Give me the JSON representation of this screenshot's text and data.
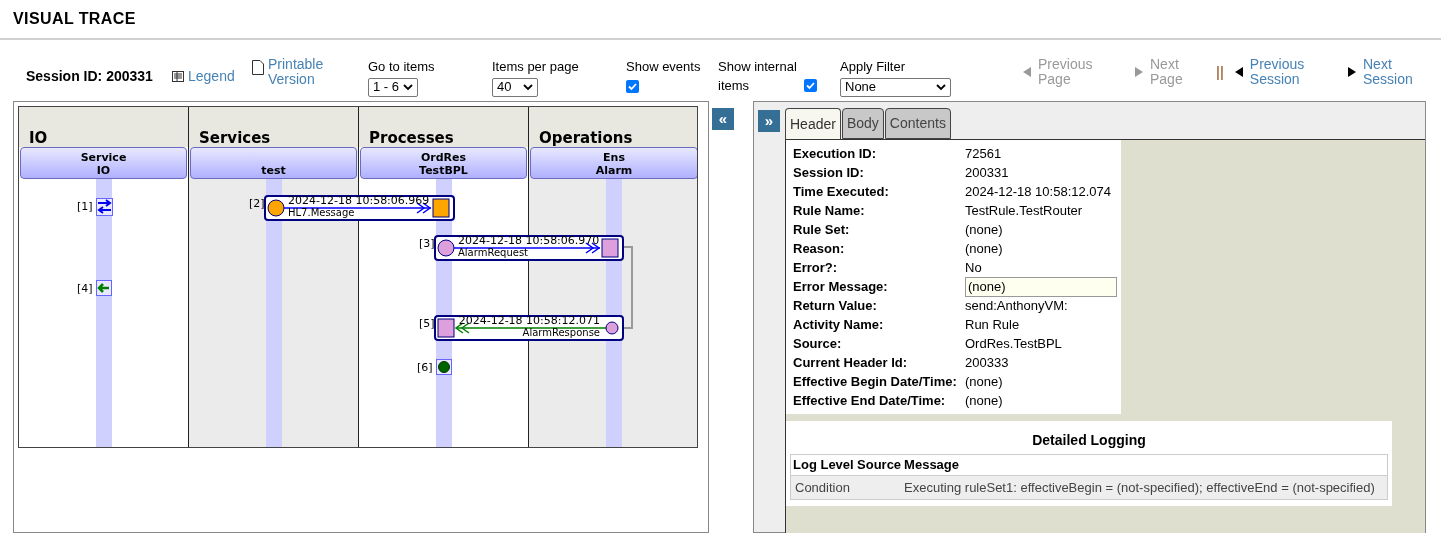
{
  "page_title": "VISUAL TRACE",
  "toolbar": {
    "session_label": "Session ID: 200331",
    "legend_link": "Legend",
    "printable_link": "Printable Version",
    "go_to_items": {
      "label": "Go to items",
      "value": "1 - 6"
    },
    "items_per_page": {
      "label": "Items per page",
      "value": "40"
    },
    "show_events": {
      "label": "Show events",
      "checked": true
    },
    "show_internal": {
      "label": "Show internal items",
      "checked": true
    },
    "apply_filter": {
      "label": "Apply Filter",
      "value": "None"
    },
    "nav": [
      {
        "kind": "prev",
        "label": "Previous Page",
        "disabled": true
      },
      {
        "kind": "next",
        "label": "Next Page",
        "disabled": true
      },
      {
        "kind": "prev",
        "label": "Previous Session",
        "disabled": false
      },
      {
        "kind": "next",
        "label": "Next Session",
        "disabled": false
      }
    ],
    "separator": "||"
  },
  "collapse_left": "«",
  "collapse_right": "»",
  "lanes": [
    {
      "title": "IO",
      "node": [
        "Service",
        "IO"
      ]
    },
    {
      "title": "Services",
      "node": [
        "test"
      ]
    },
    {
      "title": "Processes",
      "node": [
        "OrdRes",
        "TestBPL"
      ]
    },
    {
      "title": "Operations",
      "node": [
        "Ens",
        "Alarm"
      ]
    }
  ],
  "events": [
    {
      "index": "[1]",
      "kind": "io-both"
    },
    {
      "index": "[2]",
      "kind": "request",
      "time": "2024-12-18 10:58:06.969",
      "name": "HL7.Message",
      "color": "#ffa500"
    },
    {
      "index": "[3]",
      "kind": "request",
      "time": "2024-12-18 10:58:06.970",
      "name": "AlarmRequest",
      "color": "#dda0dd"
    },
    {
      "index": "[4]",
      "kind": "io-in"
    },
    {
      "index": "[5]",
      "kind": "response",
      "time": "2024-12-18 10:58:12.071",
      "name": "AlarmResponse",
      "color": "#dda0dd"
    },
    {
      "index": "[6]",
      "kind": "complete"
    }
  ],
  "tabs": [
    {
      "label": "Header",
      "selected": true
    },
    {
      "label": "Body",
      "selected": false
    },
    {
      "label": "Contents",
      "selected": false
    }
  ],
  "header_fields": [
    {
      "label": "Execution ID:",
      "value": "72561"
    },
    {
      "label": "Session ID:",
      "value": "200331"
    },
    {
      "label": "Time Executed:",
      "value": "2024-12-18 10:58:12.074"
    },
    {
      "label": "Rule Name:",
      "value": "TestRule.TestRouter"
    },
    {
      "label": "Rule Set:",
      "value": "(none)"
    },
    {
      "label": "Reason:",
      "value": "(none)"
    },
    {
      "label": "Error?:",
      "value": "No"
    },
    {
      "label": "Error Message:",
      "value": "(none)",
      "kind": "field"
    },
    {
      "label": "Return Value:",
      "value": "send:AnthonyVM:"
    },
    {
      "label": "Activity Name:",
      "value": "Run Rule"
    },
    {
      "label": "Source:",
      "value": "OrdRes.TestBPL"
    },
    {
      "label": "Current Header Id:",
      "value": "200333"
    },
    {
      "label": "Effective Begin Date/Time:",
      "value": "(none)"
    },
    {
      "label": "Effective End Date/Time:",
      "value": "(none)"
    }
  ],
  "logging": {
    "title": "Detailed Logging",
    "columns": [
      "Log Level",
      "Source",
      "Message"
    ],
    "rows": [
      {
        "log_level": "Condition",
        "message": "Executing ruleSet1: effectiveBegin = (not-specified); effectiveEnd = (not-specified)"
      }
    ]
  }
}
